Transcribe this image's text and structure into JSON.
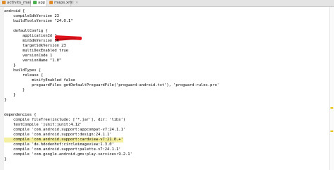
{
  "tabs": [
    {
      "label": "activity_main.xml",
      "icon_color": "#e08b2a",
      "active": false
    },
    {
      "label": "app",
      "icon_color": "#4caf50",
      "active": true
    },
    {
      "label": "maps.xml",
      "icon_color": "#e08b2a",
      "active": false
    }
  ],
  "editor": {
    "lines": [
      "android {",
      "    compileSdkVersion 23",
      "    buildToolsVersion \"24.0.1\"",
      "",
      "    defaultConfig {",
      "        applicationId \"",
      "        minSdkVersion 16",
      "        targetSdkVersion 23",
      "        multiDexEnabled true",
      "        versionCode 1",
      "        versionName \"1.0\"",
      "    }",
      "    buildTypes {",
      "        release {",
      "            minifyEnabled false",
      "            proguardFiles getDefaultProguardFile('proguard-android.txt'), 'proguard-rules.pro'",
      "        }",
      "    }",
      "}",
      "",
      "",
      "dependencies {",
      "    compile fileTree(include: ['*.jar'], dir: 'libs')",
      "    testCompile 'junit:junit:4.12'",
      "    compile 'com.android.support:appcompat-v7:24.1.1'",
      "    compile 'com.android.support:design:24.1.1'",
      "    compile 'com.android.support:cardview-v7:21.0.+'",
      "    compile 'de.hdodenhof:circleimageview:1.3.0'",
      "    compile 'com.android.support:palette-v7:24.1.1'",
      "    compile 'com.google.android.gms:play-services:9.2.1'",
      "}"
    ]
  }
}
